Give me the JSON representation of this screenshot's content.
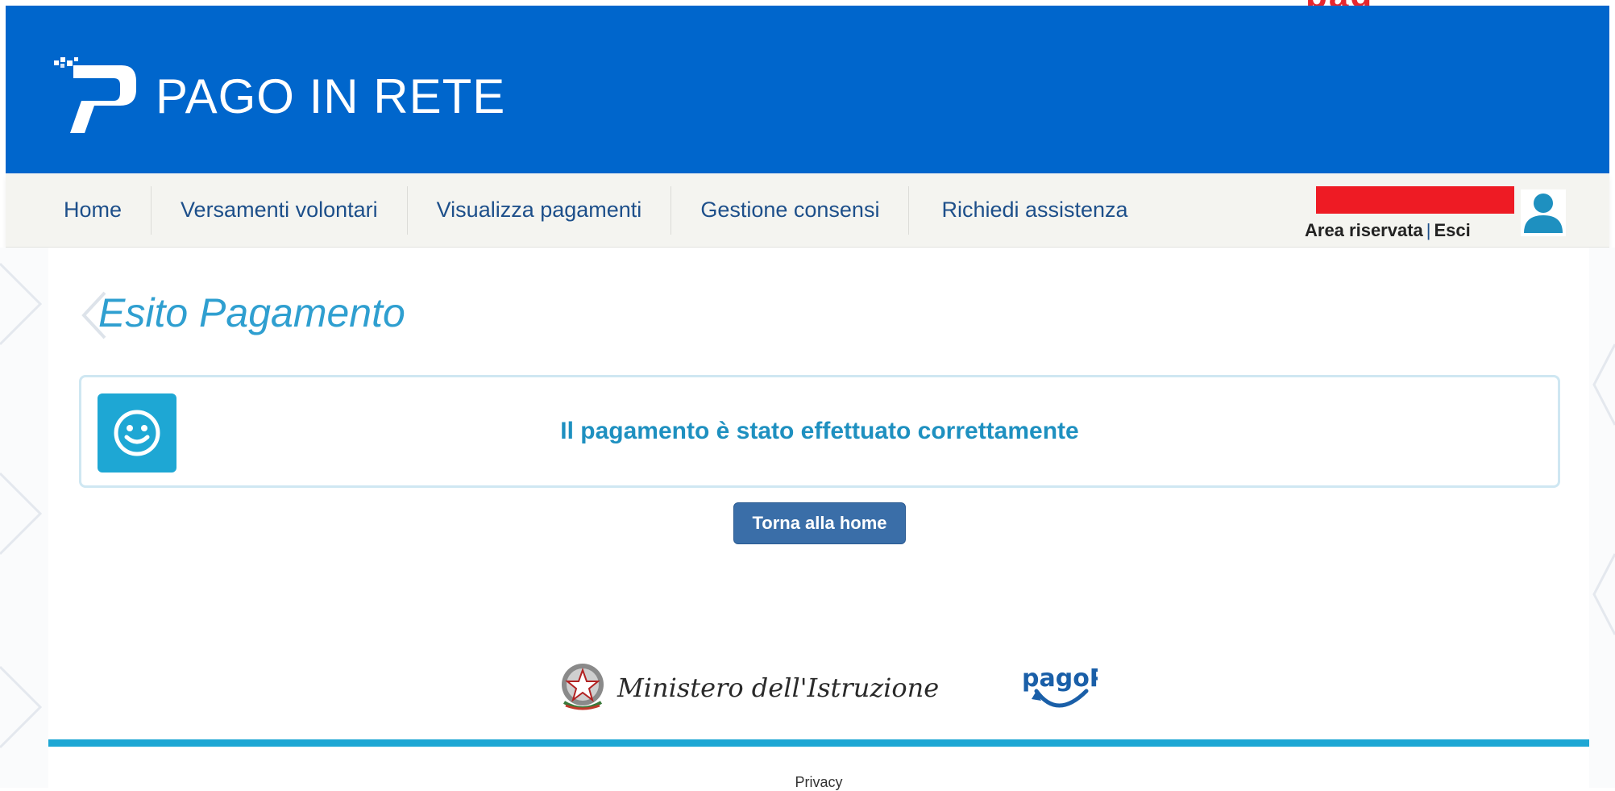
{
  "top_strip": {
    "red_text": "pag"
  },
  "header": {
    "title": "PAGO IN RETE",
    "brand_color": "#0066cc",
    "logo_icon": "pago-in-rete-p-logo"
  },
  "nav": {
    "items": [
      {
        "label": "Home"
      },
      {
        "label": "Versamenti volontari"
      },
      {
        "label": "Visualizza pagamenti"
      },
      {
        "label": "Gestione consensi"
      },
      {
        "label": "Richiedi assistenza"
      }
    ],
    "user": {
      "area_label": "Area riservata",
      "separator": "|",
      "logout_label": "Esci",
      "icon": "user-icon",
      "redacted_color": "#ee1b24"
    }
  },
  "main": {
    "title": "Esito Pagamento",
    "result": {
      "icon": "smile-icon",
      "message": "Il pagamento è stato effettuato correttamente",
      "accent_color": "#1ea7d4"
    },
    "home_button": "Torna alla home"
  },
  "footer": {
    "ministero_label": "Ministero dell'Istruzione",
    "pagopa_label": "pagoPA",
    "privacy_label": "Privacy"
  }
}
